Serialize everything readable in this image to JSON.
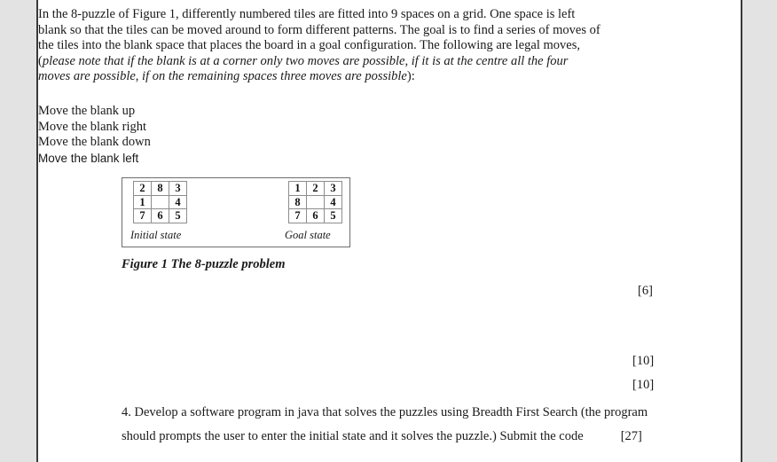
{
  "document": {
    "paragraphs": {
      "intro_part1": "In the 8-puzzle of Figure 1, differently numbered tiles are fitted into 9 spaces on a grid. One space is left blank so that the tiles can be moved around to form different patterns. The goal is to find a series of moves of the tiles into the blank space that places the board in a goal configuration. The following are legal moves, (",
      "intro_italic": "please note that if the blank is at a corner only two moves are possible, if it is at the centre all the four moves are possible, if on the remaining spaces three moves are possible",
      "intro_part2": "):"
    },
    "moves": [
      "Move the blank up",
      "Move the blank right",
      "Move the blank down",
      "Move the blank left"
    ],
    "figure": {
      "initial_state": {
        "caption": "Initial state",
        "rows": [
          [
            "2",
            "8",
            "3"
          ],
          [
            "1",
            "",
            "4"
          ],
          [
            "7",
            "6",
            "5"
          ]
        ]
      },
      "goal_state": {
        "caption": "Goal state",
        "rows": [
          [
            "1",
            "2",
            "3"
          ],
          [
            "8",
            "",
            "4"
          ],
          [
            "7",
            "6",
            "5"
          ]
        ]
      },
      "caption": "Figure 1 The 8-puzzle problem"
    },
    "marks": {
      "mark_6": "[6]",
      "mark_10_a": "[10]",
      "mark_10_b": "[10]",
      "mark_27": "[27]"
    },
    "question4": {
      "line1": "4. Develop a software program in java that solves the puzzles using Breadth First Search (the  program",
      "line2": "should prompts the user to enter the initial state and it solves the puzzle.) Submit the code"
    }
  }
}
